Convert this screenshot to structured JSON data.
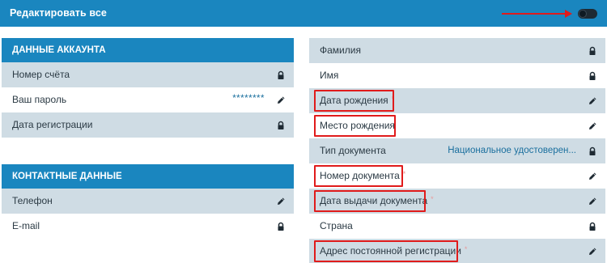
{
  "topbar": {
    "title": "Редактировать все"
  },
  "account": {
    "header": "ДАННЫЕ АККАУНТА",
    "rows": [
      {
        "label": "Номер счёта",
        "value": "",
        "icon": "lock-icon"
      },
      {
        "label": "Ваш пароль",
        "value": "********",
        "icon": "pencil-icon"
      },
      {
        "label": "Дата регистрации",
        "value": "",
        "icon": "lock-icon"
      }
    ]
  },
  "contacts": {
    "header": "КОНТАКТНЫЕ ДАННЫЕ",
    "rows": [
      {
        "label": "Телефон",
        "icon": "pencil-icon"
      },
      {
        "label": "E-mail",
        "icon": "lock-icon"
      }
    ]
  },
  "personal": {
    "rows": [
      {
        "label": "Фамилия",
        "required": "",
        "value": "",
        "icon": "lock-icon"
      },
      {
        "label": "Имя",
        "required": "",
        "value": "",
        "icon": "lock-icon"
      },
      {
        "label": "Дата рождения",
        "required": "*",
        "value": "",
        "icon": "pencil-icon"
      },
      {
        "label": "Место рождения",
        "required": "",
        "value": "",
        "icon": "pencil-icon"
      },
      {
        "label": "Тип документа",
        "required": "",
        "value": "Национальное удостоверен...",
        "icon": "lock-icon"
      },
      {
        "label": "Номер документа",
        "required": "*",
        "value": "",
        "icon": "pencil-icon"
      },
      {
        "label": "Дата выдачи документа",
        "required": "*",
        "value": "",
        "icon": "pencil-icon"
      },
      {
        "label": "Страна",
        "required": "",
        "value": "",
        "icon": "lock-icon"
      },
      {
        "label": "Адрес постоянной регистрации",
        "required": "*",
        "value": "",
        "icon": "pencil-icon"
      }
    ]
  },
  "colors": {
    "accent": "#1a86bf",
    "row_shade": "#cfdce4",
    "highlight": "#e01b1b"
  }
}
